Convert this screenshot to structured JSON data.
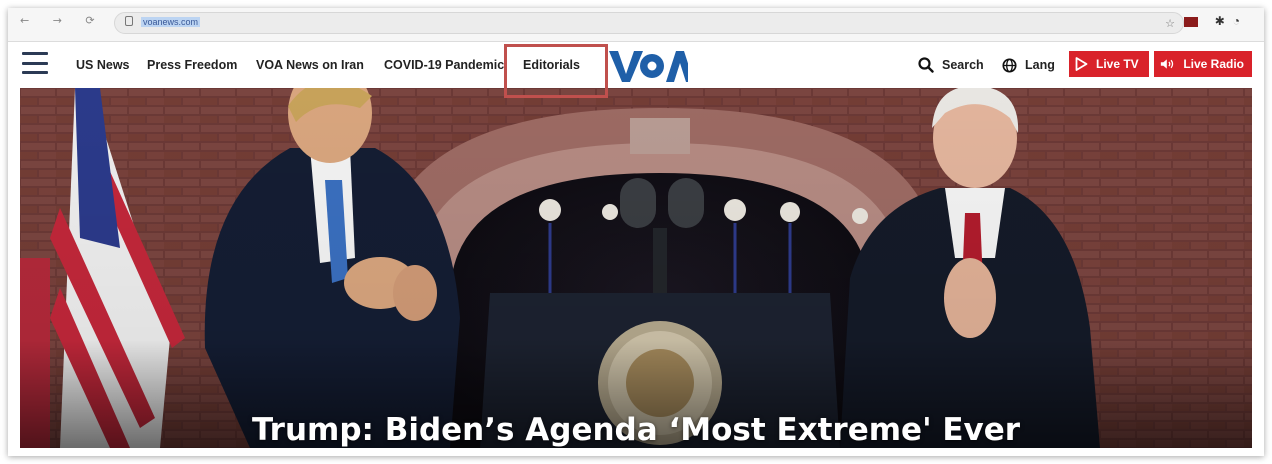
{
  "browser": {
    "url": "voanews.com"
  },
  "header": {
    "nav": [
      {
        "label": "US News"
      },
      {
        "label": "Press Freedom"
      },
      {
        "label": "VOA News on Iran"
      },
      {
        "label": "COVID-19 Pandemic"
      },
      {
        "label": "Editorials"
      }
    ],
    "logo_alt": "VOA",
    "search_label": "Search",
    "lang_label": "Lang",
    "live_tv_label": "Live TV",
    "live_radio_label": "Live Radio"
  },
  "hero": {
    "headline": "Trump: Biden’s Agenda ‘Most Extreme' Ever"
  },
  "colors": {
    "brand_blue": "#1f5fa8",
    "live_red": "#d9222a",
    "highlight": "#c0504d"
  },
  "icons": [
    "menu-icon",
    "search-icon",
    "globe-icon",
    "play-icon",
    "speaker-icon"
  ]
}
